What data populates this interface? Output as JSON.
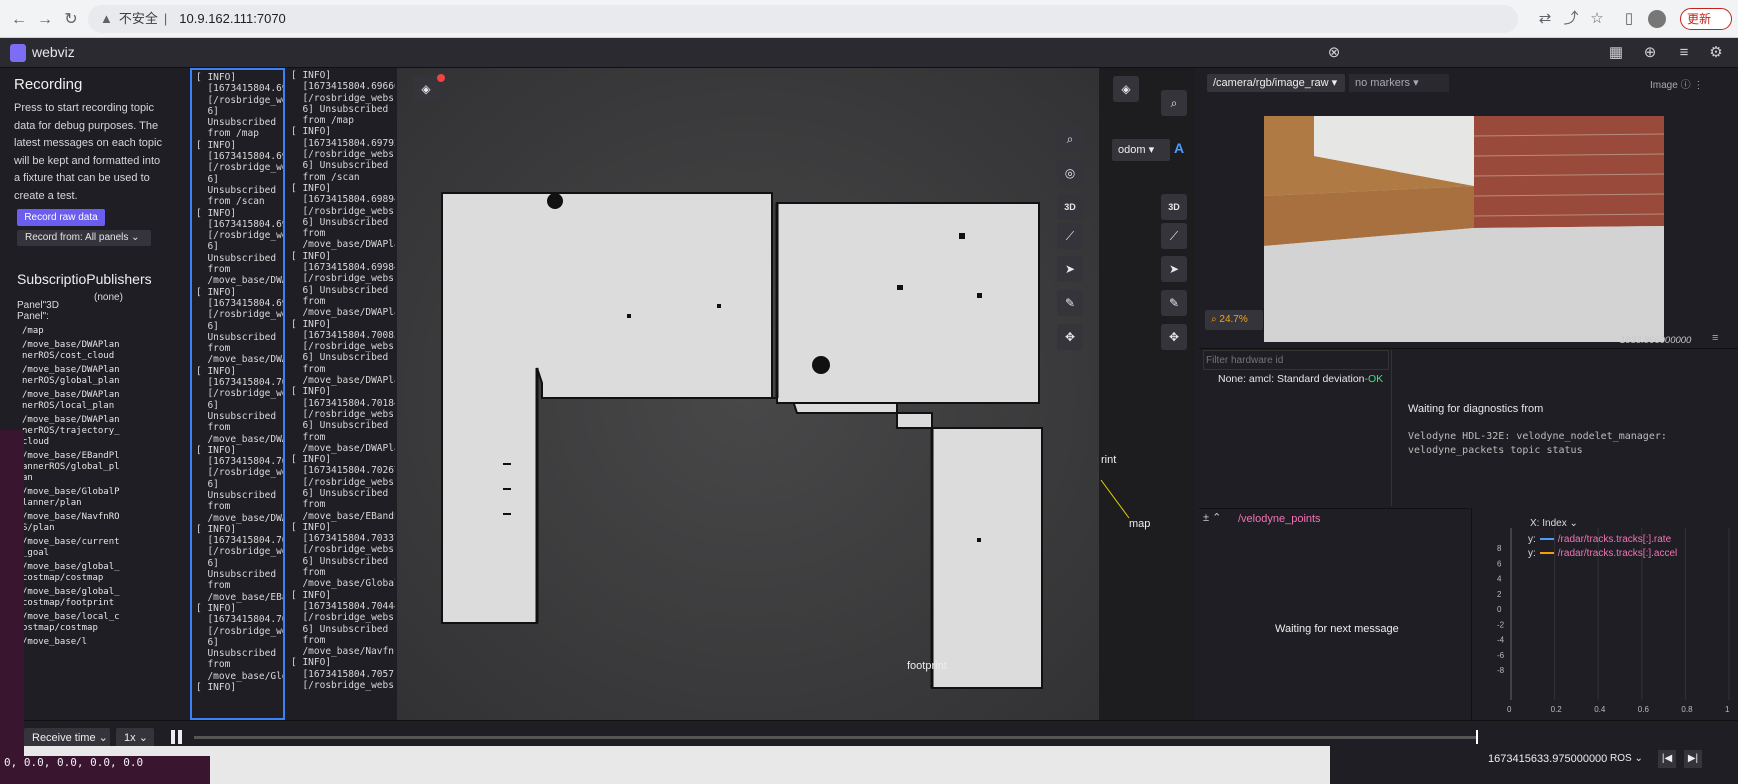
{
  "browser": {
    "security_label": "不安全",
    "url": "10.9.162.111:7070",
    "update_label": "更新"
  },
  "app": {
    "name": "webviz"
  },
  "recording": {
    "title": "Recording",
    "description": "Press to start recording topic data for debug purposes. The latest messages on each topic will be kept and formatted into a fixture that can be used to create a test.",
    "record_button": "Record raw data",
    "record_from": "Record from: All panels"
  },
  "subscriptions": {
    "header": "SubscriptioPublishers",
    "none_label": "(none)",
    "panel_label": "Panel\"3D Panel\":",
    "topics": [
      "/map",
      "/move_base/DWAPlannerROS/cost_cloud",
      "/move_base/DWAPlannerROS/global_plan",
      "/move_base/DWAPlannerROS/local_plan",
      "/move_base/DWAPlannerROS/trajectory_cloud",
      "/move_base/EBandPlannerROS/global_plan",
      "/move_base/GlobalPlanner/plan",
      "/move_base/NavfnROS/plan",
      "/move_base/current_goal",
      "/move_base/global_costmap/costmap",
      "/move_base/global_costmap/footprint",
      "/move_base/local_costmap/costmap",
      "/move_base/l"
    ]
  },
  "logs": {
    "col1": "[ INFO]\n  [1673415804.69\n  [/rosbridge_we\n  6]\n  Unsubscribed\n  from /map\n[ INFO]\n  [1673415804.69\n  [/rosbridge_we\n  6]\n  Unsubscribed\n  from /scan\n[ INFO]\n  [1673415804.69\n  [/rosbridge_we\n  6]\n  Unsubscribed\n  from\n  /move_base/DWA\n[ INFO]\n  [1673415804.69\n  [/rosbridge_we\n  6]\n  Unsubscribed\n  from\n  /move_base/DWA\n[ INFO]\n  [1673415804.70\n  [/rosbridge_we\n  6]\n  Unsubscribed\n  from\n  /move_base/DWA\n[ INFO]\n  [1673415804.70\n  [/rosbridge_we\n  6]\n  Unsubscribed\n  from\n  /move_base/DWA\n[ INFO]\n  [1673415804.70\n  [/rosbridge_we\n  6]\n  Unsubscribed\n  from\n  /move_base/EBa\n[ INFO]\n  [1673415804.70\n  [/rosbridge_we\n  6]\n  Unsubscribed\n  from\n  /move_base/Glo\n[ INFO]",
    "col2": "[ INFO]\n  [1673415804.69666\n  [/rosbridge_webs\n  6] Unsubscribed\n  from /map\n[ INFO]\n  [1673415804.69792\n  [/rosbridge_webs\n  6] Unsubscribed\n  from /scan\n[ INFO]\n  [1673415804.69894\n  [/rosbridge_webs\n  6] Unsubscribed\n  from\n  /move_base/DWAPla\n[ INFO]\n  [1673415804.69984\n  [/rosbridge_webs\n  6] Unsubscribed\n  from\n  /move_base/DWAPla\n[ INFO]\n  [1673415804.70083\n  [/rosbridge_webs\n  6] Unsubscribed\n  from\n  /move_base/DWAPla\n[ INFO]\n  [1673415804.70184\n  [/rosbridge_webs\n  6] Unsubscribed\n  from\n  /move_base/DWAPla\n[ INFO]\n  [1673415804.70267\n  [/rosbridge_webs\n  6] Unsubscribed\n  from\n  /move_base/EBandP\n[ INFO]\n  [1673415804.70337\n  [/rosbridge_webs\n  6] Unsubscribed\n  from\n  /move_base/Global\n[ INFO]\n  [1673415804.70444\n  [/rosbridge_webs\n  6] Unsubscribed\n  from\n  /move_base/Navfnf\n[ INFO]\n  [1673415804.70571\n  [/rosbridge_webs"
  },
  "map": {
    "label_3d": "3D",
    "odom_frame": "odom",
    "label_map": "map",
    "label_print": "rint",
    "label_footprint": "footprint"
  },
  "image_panel": {
    "topic": "/camera/rgb/image_raw",
    "markers": "no markers",
    "panel_label": "Image",
    "zoom": "24.7%",
    "timestamp": "1833.866000000"
  },
  "diagnostics": {
    "filter_placeholder": "Filter hardware id",
    "entry_prefix": "None: amcl: Standard deviation",
    "entry_status": "-OK",
    "waiting": "Waiting for diagnostics from",
    "detail": "Velodyne HDL-32E: velodyne_nodelet_manager: velodyne_packets topic status"
  },
  "raw_messages": {
    "topic": "/velodyne_points",
    "waiting": "Waiting for next message"
  },
  "plot": {
    "x_label": "X: Index",
    "series": [
      {
        "label": "y:",
        "path": "/radar/tracks.tracks[:].rate",
        "color": "#4a9cff"
      },
      {
        "label": "y:",
        "path": "/radar/tracks.tracks[:].accel",
        "color": "#f59e0b"
      }
    ],
    "y_ticks": [
      "8",
      "6",
      "4",
      "2",
      "0",
      "-2",
      "-4",
      "-6",
      "-8"
    ],
    "x_ticks": [
      "0",
      "0.2",
      "0.4",
      "0.6",
      "0.8",
      "1"
    ]
  },
  "playback": {
    "time_mode": "Receive time",
    "speed": "1x",
    "timestamp": "1673415633.975000000",
    "source": "ROS"
  },
  "terminal": {
    "text": "0, 0.0, 0.0, 0.0, 0.0"
  },
  "colors": {
    "accent": "#6a5df0",
    "ok": "#4ade80",
    "topic_pink": "#f472b6",
    "selection_blue": "#3b82f6"
  }
}
